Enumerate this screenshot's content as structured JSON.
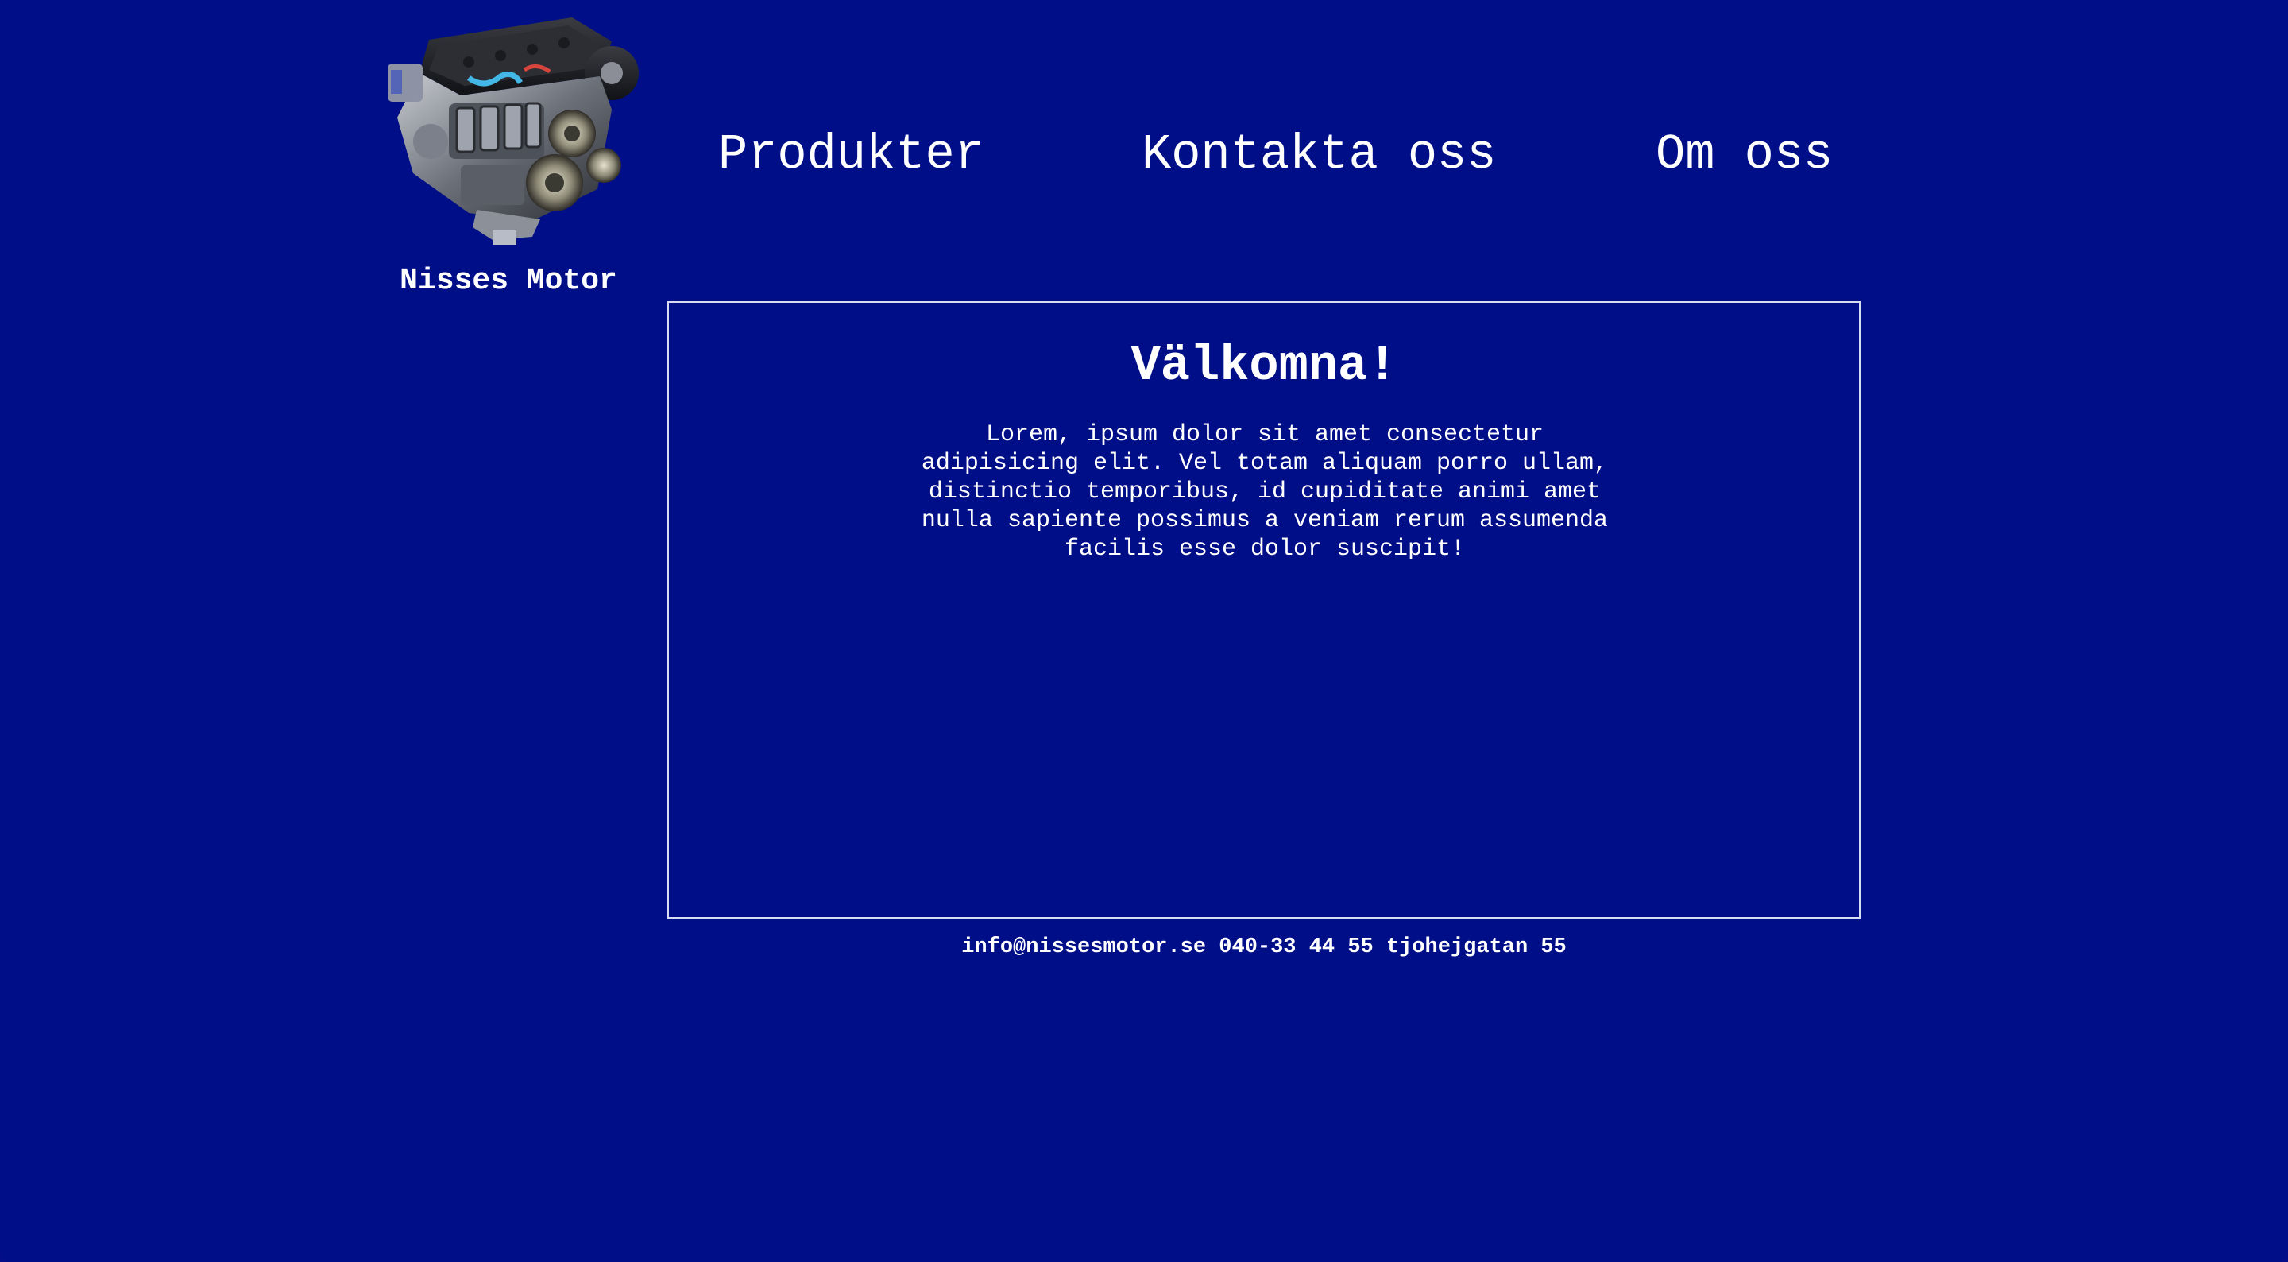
{
  "site": {
    "name": "Nisses Motor",
    "logo_icon": "engine-icon"
  },
  "nav": {
    "items": [
      {
        "label": "Produkter"
      },
      {
        "label": "Kontakta oss"
      },
      {
        "label": "Om oss"
      }
    ]
  },
  "main": {
    "title": "Välkomna!",
    "text": "Lorem, ipsum dolor sit amet consectetur adipisicing elit. Vel totam aliquam porro ullam, distinctio temporibus, id cupiditate animi amet nulla sapiente possimus a veniam rerum assumenda facilis esse dolor suscipit!"
  },
  "footer": {
    "text": "info@nissesmotor.se 040-33 44 55 tjohejgatan 55"
  },
  "colors": {
    "background": "#000e87",
    "text": "#ffffff",
    "border": "#d8dcf2"
  }
}
